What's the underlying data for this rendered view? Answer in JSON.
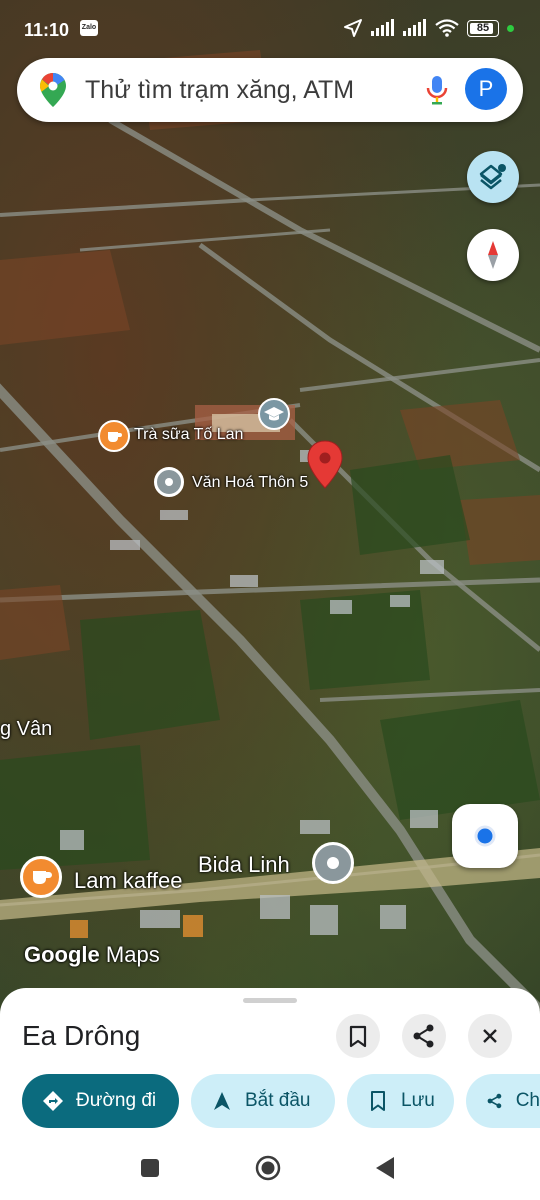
{
  "status_bar": {
    "time": "11:10",
    "notification_app": "Zalo",
    "battery": "85"
  },
  "search": {
    "placeholder": "Thử tìm trạm xăng, ATM",
    "avatar_letter": "P"
  },
  "map": {
    "labels": [
      {
        "text": "Trà sữa Tố Lan"
      },
      {
        "text": "Văn Hoá Thôn 5"
      },
      {
        "text": "g Vân"
      },
      {
        "text": "Lam kaffee"
      },
      {
        "text": "Bida Linh"
      }
    ],
    "watermark": {
      "google": "Google",
      "maps": "Maps"
    }
  },
  "place_sheet": {
    "name": "Ea Drông",
    "actions": [
      {
        "label": "Đường đi",
        "icon": "directions-icon"
      },
      {
        "label": "Bắt đầu",
        "icon": "navigation-arrow-icon"
      },
      {
        "label": "Lưu",
        "icon": "bookmark-icon"
      },
      {
        "label": "Ch",
        "icon": "share-icon"
      }
    ]
  },
  "colors": {
    "primary_chip": "#0b6b7e",
    "secondary_chip": "#cdeef8",
    "pin": "#e53935",
    "accent": "#1a73e8"
  }
}
